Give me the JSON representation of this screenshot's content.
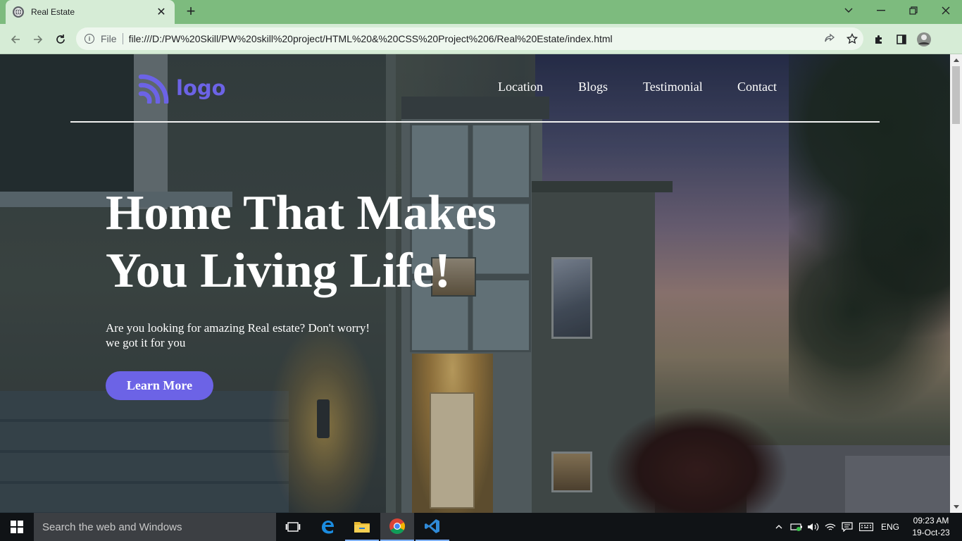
{
  "browser": {
    "tab": {
      "title": "Real Estate",
      "favicon": "globe-icon"
    },
    "address": {
      "scheme_label": "File",
      "url": "file:///D:/PW%20Skill/PW%20skill%20project/HTML%20&%20CSS%20Project%206/Real%20Estate/index.html"
    },
    "icons": [
      "back-arrow-icon",
      "forward-arrow-icon",
      "reload-icon",
      "info-icon",
      "share-icon",
      "star-icon",
      "extensions-icon",
      "side-panel-icon",
      "profile-avatar"
    ]
  },
  "site": {
    "logo_text": "logo",
    "nav": [
      "Location",
      "Blogs",
      "Testimonial",
      "Contact"
    ],
    "hero": {
      "title_line1": "Home That Makes",
      "title_line2": "You Living Life!",
      "subtitle_line1": "Are you looking for amazing Real estate? Don't worry!",
      "subtitle_line2": "we got it for you",
      "cta": "Learn More"
    },
    "accent_color": "#6c63e6"
  },
  "taskbar": {
    "search_placeholder": "Search the web and Windows",
    "language": "ENG",
    "time": "09:23 AM",
    "date": "19-Oct-23",
    "apps": [
      "task-view-icon",
      "edge-icon",
      "file-explorer-icon",
      "chrome-icon",
      "vscode-icon"
    ]
  }
}
